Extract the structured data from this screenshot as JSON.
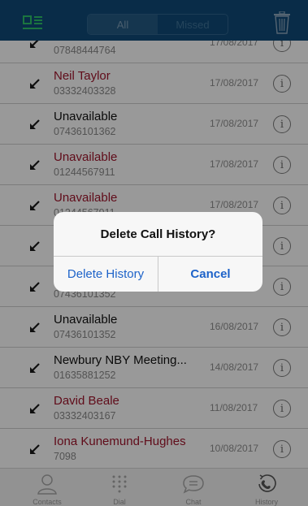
{
  "header": {
    "segments": [
      "All",
      "Missed"
    ],
    "selected_segment": "All",
    "menu_icon": "sidebar-menu-icon",
    "trash_icon": "trash-icon",
    "bg_color": "#0f4a78",
    "accent_color": "#2ec46a"
  },
  "calls": [
    {
      "name": "",
      "number": "07848444764",
      "date": "17/08/2017",
      "missed": false
    },
    {
      "name": "Neil Taylor",
      "number": "03332403328",
      "date": "17/08/2017",
      "missed": true
    },
    {
      "name": "Unavailable",
      "number": "07436101362",
      "date": "17/08/2017",
      "missed": false
    },
    {
      "name": "Unavailable",
      "number": "01244567911",
      "date": "17/08/2017",
      "missed": true
    },
    {
      "name": "Unavailable",
      "number": "01244567911",
      "date": "17/08/2017",
      "missed": true
    },
    {
      "name": "",
      "number": "",
      "date": "",
      "missed": false
    },
    {
      "name": "",
      "number": "07436101352",
      "date": "",
      "missed": false
    },
    {
      "name": "Unavailable",
      "number": "07436101352",
      "date": "16/08/2017",
      "missed": false
    },
    {
      "name": "Newbury NBY Meeting...",
      "number": "01635881252",
      "date": "14/08/2017",
      "missed": false
    },
    {
      "name": "David Beale",
      "number": "03332403167",
      "date": "11/08/2017",
      "missed": true
    },
    {
      "name": "Iona Kunemund-Hughes",
      "number": "7098",
      "date": "10/08/2017",
      "missed": true
    }
  ],
  "tabbar": {
    "tabs": [
      {
        "label": "Contacts",
        "icon": "person-icon"
      },
      {
        "label": "Dial",
        "icon": "keypad-icon"
      },
      {
        "label": "Chat",
        "icon": "chat-bubble-icon"
      },
      {
        "label": "History",
        "icon": "history-phone-icon"
      }
    ]
  },
  "dialog": {
    "title": "Delete Call History?",
    "confirm_label": "Delete History",
    "cancel_label": "Cancel",
    "button_color": "#1e63c9"
  }
}
